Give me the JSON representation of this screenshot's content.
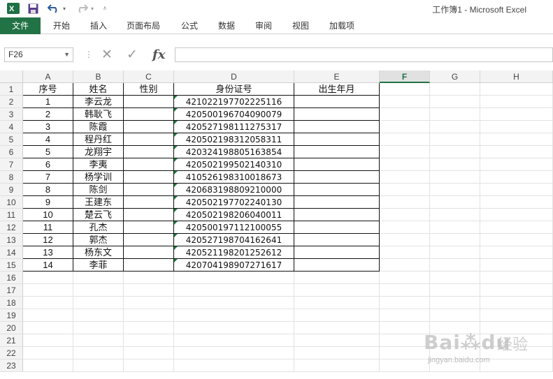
{
  "titlebar": {
    "title": "工作簿1 - Microsoft Excel",
    "excel_icon": "excel-icon",
    "save_icon": "save-icon",
    "undo_icon": "undo-icon",
    "redo_icon": "redo-icon",
    "customize_icon": "customize-quick-access-icon"
  },
  "ribbon": {
    "tabs": [
      "文件",
      "开始",
      "插入",
      "页面布局",
      "公式",
      "数据",
      "审阅",
      "视图",
      "加载项"
    ],
    "file_color": "#217346"
  },
  "formulabar": {
    "namebox": "F26",
    "cancel_icon": "✕",
    "enter_icon": "✓",
    "fx_label": "fx",
    "formula": ""
  },
  "sheet": {
    "columns": [
      "A",
      "B",
      "C",
      "D",
      "E",
      "F",
      "G",
      "H"
    ],
    "selected_column": "F",
    "rows": [
      "1",
      "2",
      "3",
      "4",
      "5",
      "6",
      "7",
      "8",
      "9",
      "10",
      "11",
      "12",
      "13",
      "14",
      "15",
      "16",
      "17",
      "18",
      "19",
      "20",
      "21",
      "22",
      "23"
    ],
    "headers": [
      "序号",
      "姓名",
      "性别",
      "身份证号",
      "出生年月"
    ],
    "data": [
      [
        "1",
        "李云龙",
        "",
        "421022197702225116",
        ""
      ],
      [
        "2",
        "韩耿飞",
        "",
        "420500196704090079",
        ""
      ],
      [
        "3",
        "陈霞",
        "",
        "420527198111275317",
        ""
      ],
      [
        "4",
        "程丹红",
        "",
        "420502198312058311",
        ""
      ],
      [
        "5",
        "龙翔宇",
        "",
        "420324198805163854",
        ""
      ],
      [
        "6",
        "李夷",
        "",
        "420502199502140310",
        ""
      ],
      [
        "7",
        "杨学训",
        "",
        "410526198310018673",
        ""
      ],
      [
        "8",
        "陈剑",
        "",
        "420683198809210000",
        ""
      ],
      [
        "9",
        "王建东",
        "",
        "420502197702240130",
        ""
      ],
      [
        "10",
        "楚云飞",
        "",
        "420502198206040011",
        ""
      ],
      [
        "11",
        "孔杰",
        "",
        "420500197112100055",
        ""
      ],
      [
        "12",
        "郭杰",
        "",
        "420527198704162641",
        ""
      ],
      [
        "13",
        "杨东文",
        "",
        "420521198201252612",
        ""
      ],
      [
        "14",
        "李菲",
        "",
        "420704198907271617",
        ""
      ]
    ],
    "accent_color": "#217346"
  },
  "watermark": {
    "logo": "Bai⁂du",
    "text": "经验",
    "url": "jingyan.baidu.com"
  }
}
